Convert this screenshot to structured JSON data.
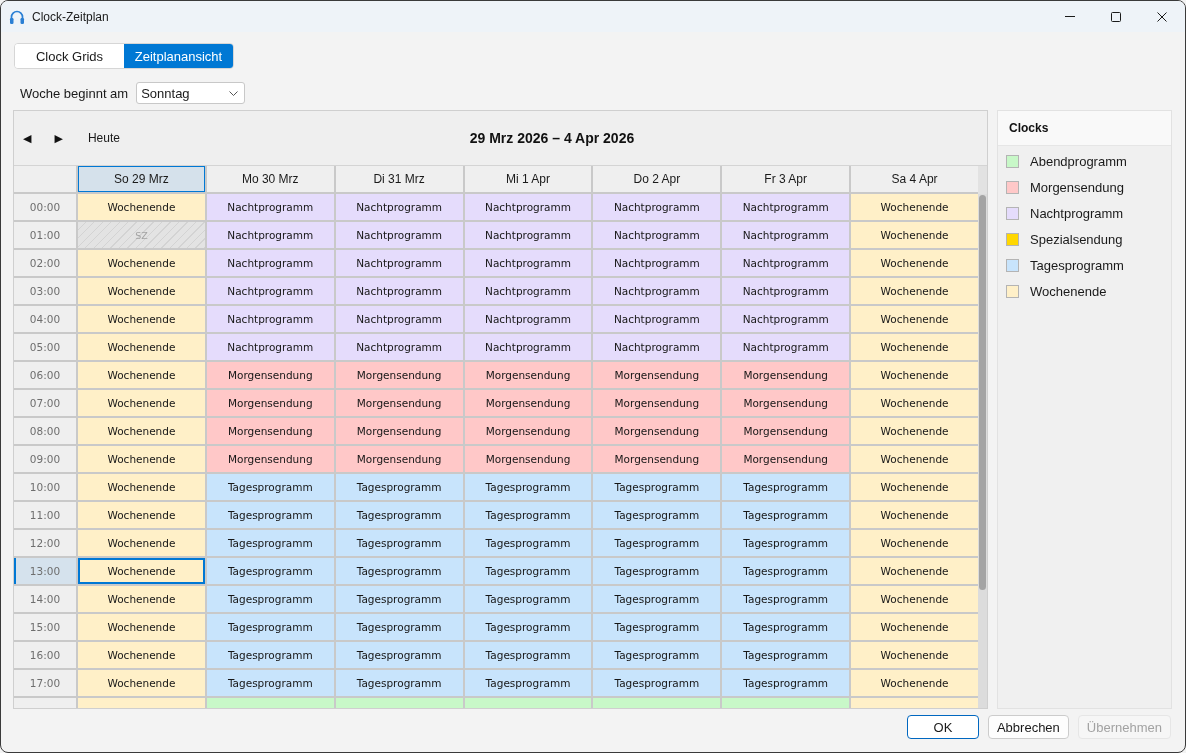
{
  "window": {
    "title": "Clock-Zeitplan"
  },
  "tabs": [
    {
      "label": "Clock Grids",
      "selected": false
    },
    {
      "label": "Zeitplanansicht",
      "selected": true
    }
  ],
  "week_start": {
    "label": "Woche beginnt am",
    "value": "Sonntag"
  },
  "schedule": {
    "prev_button": "◀",
    "next_button": "▶",
    "today_button": "Heute",
    "range_title": "29 Mrz 2026 – 4 Apr 2026",
    "days": [
      {
        "label": "So 29 Mrz",
        "selected": true
      },
      {
        "label": "Mo 30 Mrz",
        "selected": false
      },
      {
        "label": "Di 31 Mrz",
        "selected": false
      },
      {
        "label": "Mi 1 Apr",
        "selected": false
      },
      {
        "label": "Do 2 Apr",
        "selected": false
      },
      {
        "label": "Fr 3 Apr",
        "selected": false
      },
      {
        "label": "Sa 4 Apr",
        "selected": false
      }
    ],
    "rows": [
      {
        "time": "00:00",
        "selected": false,
        "cells": [
          {
            "kind": "slot",
            "label": "Wochenende",
            "color": "#fff0c8",
            "selected": false
          },
          {
            "kind": "slot",
            "label": "Nachtprogramm",
            "color": "#e5dcfc",
            "selected": false
          },
          {
            "kind": "slot",
            "label": "Nachtprogramm",
            "color": "#e5dcfc",
            "selected": false
          },
          {
            "kind": "slot",
            "label": "Nachtprogramm",
            "color": "#e5dcfc",
            "selected": false
          },
          {
            "kind": "slot",
            "label": "Nachtprogramm",
            "color": "#e5dcfc",
            "selected": false
          },
          {
            "kind": "slot",
            "label": "Nachtprogramm",
            "color": "#e5dcfc",
            "selected": false
          },
          {
            "kind": "slot",
            "label": "Wochenende",
            "color": "#fff0c8",
            "selected": false
          }
        ]
      },
      {
        "time": "01:00",
        "selected": false,
        "cells": [
          {
            "kind": "gap",
            "label": "SZ",
            "selected": false
          },
          {
            "kind": "slot",
            "label": "Nachtprogramm",
            "color": "#e5dcfc",
            "selected": false
          },
          {
            "kind": "slot",
            "label": "Nachtprogramm",
            "color": "#e5dcfc",
            "selected": false
          },
          {
            "kind": "slot",
            "label": "Nachtprogramm",
            "color": "#e5dcfc",
            "selected": false
          },
          {
            "kind": "slot",
            "label": "Nachtprogramm",
            "color": "#e5dcfc",
            "selected": false
          },
          {
            "kind": "slot",
            "label": "Nachtprogramm",
            "color": "#e5dcfc",
            "selected": false
          },
          {
            "kind": "slot",
            "label": "Wochenende",
            "color": "#fff0c8",
            "selected": false
          }
        ]
      },
      {
        "time": "02:00",
        "selected": false,
        "cells": [
          {
            "kind": "slot",
            "label": "Wochenende",
            "color": "#fff0c8",
            "selected": false
          },
          {
            "kind": "slot",
            "label": "Nachtprogramm",
            "color": "#e5dcfc",
            "selected": false
          },
          {
            "kind": "slot",
            "label": "Nachtprogramm",
            "color": "#e5dcfc",
            "selected": false
          },
          {
            "kind": "slot",
            "label": "Nachtprogramm",
            "color": "#e5dcfc",
            "selected": false
          },
          {
            "kind": "slot",
            "label": "Nachtprogramm",
            "color": "#e5dcfc",
            "selected": false
          },
          {
            "kind": "slot",
            "label": "Nachtprogramm",
            "color": "#e5dcfc",
            "selected": false
          },
          {
            "kind": "slot",
            "label": "Wochenende",
            "color": "#fff0c8",
            "selected": false
          }
        ]
      },
      {
        "time": "03:00",
        "selected": false,
        "cells": [
          {
            "kind": "slot",
            "label": "Wochenende",
            "color": "#fff0c8",
            "selected": false
          },
          {
            "kind": "slot",
            "label": "Nachtprogramm",
            "color": "#e5dcfc",
            "selected": false
          },
          {
            "kind": "slot",
            "label": "Nachtprogramm",
            "color": "#e5dcfc",
            "selected": false
          },
          {
            "kind": "slot",
            "label": "Nachtprogramm",
            "color": "#e5dcfc",
            "selected": false
          },
          {
            "kind": "slot",
            "label": "Nachtprogramm",
            "color": "#e5dcfc",
            "selected": false
          },
          {
            "kind": "slot",
            "label": "Nachtprogramm",
            "color": "#e5dcfc",
            "selected": false
          },
          {
            "kind": "slot",
            "label": "Wochenende",
            "color": "#fff0c8",
            "selected": false
          }
        ]
      },
      {
        "time": "04:00",
        "selected": false,
        "cells": [
          {
            "kind": "slot",
            "label": "Wochenende",
            "color": "#fff0c8",
            "selected": false
          },
          {
            "kind": "slot",
            "label": "Nachtprogramm",
            "color": "#e5dcfc",
            "selected": false
          },
          {
            "kind": "slot",
            "label": "Nachtprogramm",
            "color": "#e5dcfc",
            "selected": false
          },
          {
            "kind": "slot",
            "label": "Nachtprogramm",
            "color": "#e5dcfc",
            "selected": false
          },
          {
            "kind": "slot",
            "label": "Nachtprogramm",
            "color": "#e5dcfc",
            "selected": false
          },
          {
            "kind": "slot",
            "label": "Nachtprogramm",
            "color": "#e5dcfc",
            "selected": false
          },
          {
            "kind": "slot",
            "label": "Wochenende",
            "color": "#fff0c8",
            "selected": false
          }
        ]
      },
      {
        "time": "05:00",
        "selected": false,
        "cells": [
          {
            "kind": "slot",
            "label": "Wochenende",
            "color": "#fff0c8",
            "selected": false
          },
          {
            "kind": "slot",
            "label": "Nachtprogramm",
            "color": "#e5dcfc",
            "selected": false
          },
          {
            "kind": "slot",
            "label": "Nachtprogramm",
            "color": "#e5dcfc",
            "selected": false
          },
          {
            "kind": "slot",
            "label": "Nachtprogramm",
            "color": "#e5dcfc",
            "selected": false
          },
          {
            "kind": "slot",
            "label": "Nachtprogramm",
            "color": "#e5dcfc",
            "selected": false
          },
          {
            "kind": "slot",
            "label": "Nachtprogramm",
            "color": "#e5dcfc",
            "selected": false
          },
          {
            "kind": "slot",
            "label": "Wochenende",
            "color": "#fff0c8",
            "selected": false
          }
        ]
      },
      {
        "time": "06:00",
        "selected": false,
        "cells": [
          {
            "kind": "slot",
            "label": "Wochenende",
            "color": "#fff0c8",
            "selected": false
          },
          {
            "kind": "slot",
            "label": "Morgensendung",
            "color": "#ffc8c8",
            "selected": false
          },
          {
            "kind": "slot",
            "label": "Morgensendung",
            "color": "#ffc8c8",
            "selected": false
          },
          {
            "kind": "slot",
            "label": "Morgensendung",
            "color": "#ffc8c8",
            "selected": false
          },
          {
            "kind": "slot",
            "label": "Morgensendung",
            "color": "#ffc8c8",
            "selected": false
          },
          {
            "kind": "slot",
            "label": "Morgensendung",
            "color": "#ffc8c8",
            "selected": false
          },
          {
            "kind": "slot",
            "label": "Wochenende",
            "color": "#fff0c8",
            "selected": false
          }
        ]
      },
      {
        "time": "07:00",
        "selected": false,
        "cells": [
          {
            "kind": "slot",
            "label": "Wochenende",
            "color": "#fff0c8",
            "selected": false
          },
          {
            "kind": "slot",
            "label": "Morgensendung",
            "color": "#ffc8c8",
            "selected": false
          },
          {
            "kind": "slot",
            "label": "Morgensendung",
            "color": "#ffc8c8",
            "selected": false
          },
          {
            "kind": "slot",
            "label": "Morgensendung",
            "color": "#ffc8c8",
            "selected": false
          },
          {
            "kind": "slot",
            "label": "Morgensendung",
            "color": "#ffc8c8",
            "selected": false
          },
          {
            "kind": "slot",
            "label": "Morgensendung",
            "color": "#ffc8c8",
            "selected": false
          },
          {
            "kind": "slot",
            "label": "Wochenende",
            "color": "#fff0c8",
            "selected": false
          }
        ]
      },
      {
        "time": "08:00",
        "selected": false,
        "cells": [
          {
            "kind": "slot",
            "label": "Wochenende",
            "color": "#fff0c8",
            "selected": false
          },
          {
            "kind": "slot",
            "label": "Morgensendung",
            "color": "#ffc8c8",
            "selected": false
          },
          {
            "kind": "slot",
            "label": "Morgensendung",
            "color": "#ffc8c8",
            "selected": false
          },
          {
            "kind": "slot",
            "label": "Morgensendung",
            "color": "#ffc8c8",
            "selected": false
          },
          {
            "kind": "slot",
            "label": "Morgensendung",
            "color": "#ffc8c8",
            "selected": false
          },
          {
            "kind": "slot",
            "label": "Morgensendung",
            "color": "#ffc8c8",
            "selected": false
          },
          {
            "kind": "slot",
            "label": "Wochenende",
            "color": "#fff0c8",
            "selected": false
          }
        ]
      },
      {
        "time": "09:00",
        "selected": false,
        "cells": [
          {
            "kind": "slot",
            "label": "Wochenende",
            "color": "#fff0c8",
            "selected": false
          },
          {
            "kind": "slot",
            "label": "Morgensendung",
            "color": "#ffc8c8",
            "selected": false
          },
          {
            "kind": "slot",
            "label": "Morgensendung",
            "color": "#ffc8c8",
            "selected": false
          },
          {
            "kind": "slot",
            "label": "Morgensendung",
            "color": "#ffc8c8",
            "selected": false
          },
          {
            "kind": "slot",
            "label": "Morgensendung",
            "color": "#ffc8c8",
            "selected": false
          },
          {
            "kind": "slot",
            "label": "Morgensendung",
            "color": "#ffc8c8",
            "selected": false
          },
          {
            "kind": "slot",
            "label": "Wochenende",
            "color": "#fff0c8",
            "selected": false
          }
        ]
      },
      {
        "time": "10:00",
        "selected": false,
        "cells": [
          {
            "kind": "slot",
            "label": "Wochenende",
            "color": "#fff0c8",
            "selected": false
          },
          {
            "kind": "slot",
            "label": "Tagesprogramm",
            "color": "#c8e4fc",
            "selected": false
          },
          {
            "kind": "slot",
            "label": "Tagesprogramm",
            "color": "#c8e4fc",
            "selected": false
          },
          {
            "kind": "slot",
            "label": "Tagesprogramm",
            "color": "#c8e4fc",
            "selected": false
          },
          {
            "kind": "slot",
            "label": "Tagesprogramm",
            "color": "#c8e4fc",
            "selected": false
          },
          {
            "kind": "slot",
            "label": "Tagesprogramm",
            "color": "#c8e4fc",
            "selected": false
          },
          {
            "kind": "slot",
            "label": "Wochenende",
            "color": "#fff0c8",
            "selected": false
          }
        ]
      },
      {
        "time": "11:00",
        "selected": false,
        "cells": [
          {
            "kind": "slot",
            "label": "Wochenende",
            "color": "#fff0c8",
            "selected": false
          },
          {
            "kind": "slot",
            "label": "Tagesprogramm",
            "color": "#c8e4fc",
            "selected": false
          },
          {
            "kind": "slot",
            "label": "Tagesprogramm",
            "color": "#c8e4fc",
            "selected": false
          },
          {
            "kind": "slot",
            "label": "Tagesprogramm",
            "color": "#c8e4fc",
            "selected": false
          },
          {
            "kind": "slot",
            "label": "Tagesprogramm",
            "color": "#c8e4fc",
            "selected": false
          },
          {
            "kind": "slot",
            "label": "Tagesprogramm",
            "color": "#c8e4fc",
            "selected": false
          },
          {
            "kind": "slot",
            "label": "Wochenende",
            "color": "#fff0c8",
            "selected": false
          }
        ]
      },
      {
        "time": "12:00",
        "selected": false,
        "cells": [
          {
            "kind": "slot",
            "label": "Wochenende",
            "color": "#fff0c8",
            "selected": false
          },
          {
            "kind": "slot",
            "label": "Tagesprogramm",
            "color": "#c8e4fc",
            "selected": false
          },
          {
            "kind": "slot",
            "label": "Tagesprogramm",
            "color": "#c8e4fc",
            "selected": false
          },
          {
            "kind": "slot",
            "label": "Tagesprogramm",
            "color": "#c8e4fc",
            "selected": false
          },
          {
            "kind": "slot",
            "label": "Tagesprogramm",
            "color": "#c8e4fc",
            "selected": false
          },
          {
            "kind": "slot",
            "label": "Tagesprogramm",
            "color": "#c8e4fc",
            "selected": false
          },
          {
            "kind": "slot",
            "label": "Wochenende",
            "color": "#fff0c8",
            "selected": false
          }
        ]
      },
      {
        "time": "13:00",
        "selected": true,
        "cells": [
          {
            "kind": "slot",
            "label": "Wochenende",
            "color": "#fff0c8",
            "selected": true
          },
          {
            "kind": "slot",
            "label": "Tagesprogramm",
            "color": "#c8e4fc",
            "selected": false
          },
          {
            "kind": "slot",
            "label": "Tagesprogramm",
            "color": "#c8e4fc",
            "selected": false
          },
          {
            "kind": "slot",
            "label": "Tagesprogramm",
            "color": "#c8e4fc",
            "selected": false
          },
          {
            "kind": "slot",
            "label": "Tagesprogramm",
            "color": "#c8e4fc",
            "selected": false
          },
          {
            "kind": "slot",
            "label": "Tagesprogramm",
            "color": "#c8e4fc",
            "selected": false
          },
          {
            "kind": "slot",
            "label": "Wochenende",
            "color": "#fff0c8",
            "selected": false
          }
        ]
      },
      {
        "time": "14:00",
        "selected": false,
        "cells": [
          {
            "kind": "slot",
            "label": "Wochenende",
            "color": "#fff0c8",
            "selected": false
          },
          {
            "kind": "slot",
            "label": "Tagesprogramm",
            "color": "#c8e4fc",
            "selected": false
          },
          {
            "kind": "slot",
            "label": "Tagesprogramm",
            "color": "#c8e4fc",
            "selected": false
          },
          {
            "kind": "slot",
            "label": "Tagesprogramm",
            "color": "#c8e4fc",
            "selected": false
          },
          {
            "kind": "slot",
            "label": "Tagesprogramm",
            "color": "#c8e4fc",
            "selected": false
          },
          {
            "kind": "slot",
            "label": "Tagesprogramm",
            "color": "#c8e4fc",
            "selected": false
          },
          {
            "kind": "slot",
            "label": "Wochenende",
            "color": "#fff0c8",
            "selected": false
          }
        ]
      },
      {
        "time": "15:00",
        "selected": false,
        "cells": [
          {
            "kind": "slot",
            "label": "Wochenende",
            "color": "#fff0c8",
            "selected": false
          },
          {
            "kind": "slot",
            "label": "Tagesprogramm",
            "color": "#c8e4fc",
            "selected": false
          },
          {
            "kind": "slot",
            "label": "Tagesprogramm",
            "color": "#c8e4fc",
            "selected": false
          },
          {
            "kind": "slot",
            "label": "Tagesprogramm",
            "color": "#c8e4fc",
            "selected": false
          },
          {
            "kind": "slot",
            "label": "Tagesprogramm",
            "color": "#c8e4fc",
            "selected": false
          },
          {
            "kind": "slot",
            "label": "Tagesprogramm",
            "color": "#c8e4fc",
            "selected": false
          },
          {
            "kind": "slot",
            "label": "Wochenende",
            "color": "#fff0c8",
            "selected": false
          }
        ]
      },
      {
        "time": "16:00",
        "selected": false,
        "cells": [
          {
            "kind": "slot",
            "label": "Wochenende",
            "color": "#fff0c8",
            "selected": false
          },
          {
            "kind": "slot",
            "label": "Tagesprogramm",
            "color": "#c8e4fc",
            "selected": false
          },
          {
            "kind": "slot",
            "label": "Tagesprogramm",
            "color": "#c8e4fc",
            "selected": false
          },
          {
            "kind": "slot",
            "label": "Tagesprogramm",
            "color": "#c8e4fc",
            "selected": false
          },
          {
            "kind": "slot",
            "label": "Tagesprogramm",
            "color": "#c8e4fc",
            "selected": false
          },
          {
            "kind": "slot",
            "label": "Tagesprogramm",
            "color": "#c8e4fc",
            "selected": false
          },
          {
            "kind": "slot",
            "label": "Wochenende",
            "color": "#fff0c8",
            "selected": false
          }
        ]
      },
      {
        "time": "17:00",
        "selected": false,
        "cells": [
          {
            "kind": "slot",
            "label": "Wochenende",
            "color": "#fff0c8",
            "selected": false
          },
          {
            "kind": "slot",
            "label": "Tagesprogramm",
            "color": "#c8e4fc",
            "selected": false
          },
          {
            "kind": "slot",
            "label": "Tagesprogramm",
            "color": "#c8e4fc",
            "selected": false
          },
          {
            "kind": "slot",
            "label": "Tagesprogramm",
            "color": "#c8e4fc",
            "selected": false
          },
          {
            "kind": "slot",
            "label": "Tagesprogramm",
            "color": "#c8e4fc",
            "selected": false
          },
          {
            "kind": "slot",
            "label": "Tagesprogramm",
            "color": "#c8e4fc",
            "selected": false
          },
          {
            "kind": "slot",
            "label": "Wochenende",
            "color": "#fff0c8",
            "selected": false
          }
        ]
      },
      {
        "selected": false,
        "cells": [
          {
            "kind": "slot",
            "color": "#fff0c8",
            "selected": false
          },
          {
            "kind": "slot",
            "color": "#c8f8c8",
            "selected": false
          },
          {
            "kind": "slot",
            "color": "#c8f8c8",
            "selected": false
          },
          {
            "kind": "slot",
            "color": "#c8f8c8",
            "selected": false
          },
          {
            "kind": "slot",
            "color": "#c8f8c8",
            "selected": false
          },
          {
            "kind": "slot",
            "color": "#c8f8c8",
            "selected": false
          },
          {
            "kind": "slot",
            "color": "#fff0c8",
            "selected": false
          }
        ]
      }
    ]
  },
  "legend": {
    "title": "Clocks",
    "items": [
      {
        "name": "Abendprogramm",
        "color": "#c8f8c8"
      },
      {
        "name": "Morgensendung",
        "color": "#ffc8c8"
      },
      {
        "name": "Nachtprogramm",
        "color": "#e5dcfc"
      },
      {
        "name": "Spezialsendung",
        "color": "#ffd700"
      },
      {
        "name": "Tagesprogramm",
        "color": "#c8e4fc"
      },
      {
        "name": "Wochenende",
        "color": "#fff0c8"
      }
    ]
  },
  "buttons": [
    {
      "label": "OK",
      "default": true,
      "disabled": false
    },
    {
      "label": "Abbrechen",
      "default": false,
      "disabled": false
    },
    {
      "label": "Übernehmen",
      "default": false,
      "disabled": true
    }
  ]
}
